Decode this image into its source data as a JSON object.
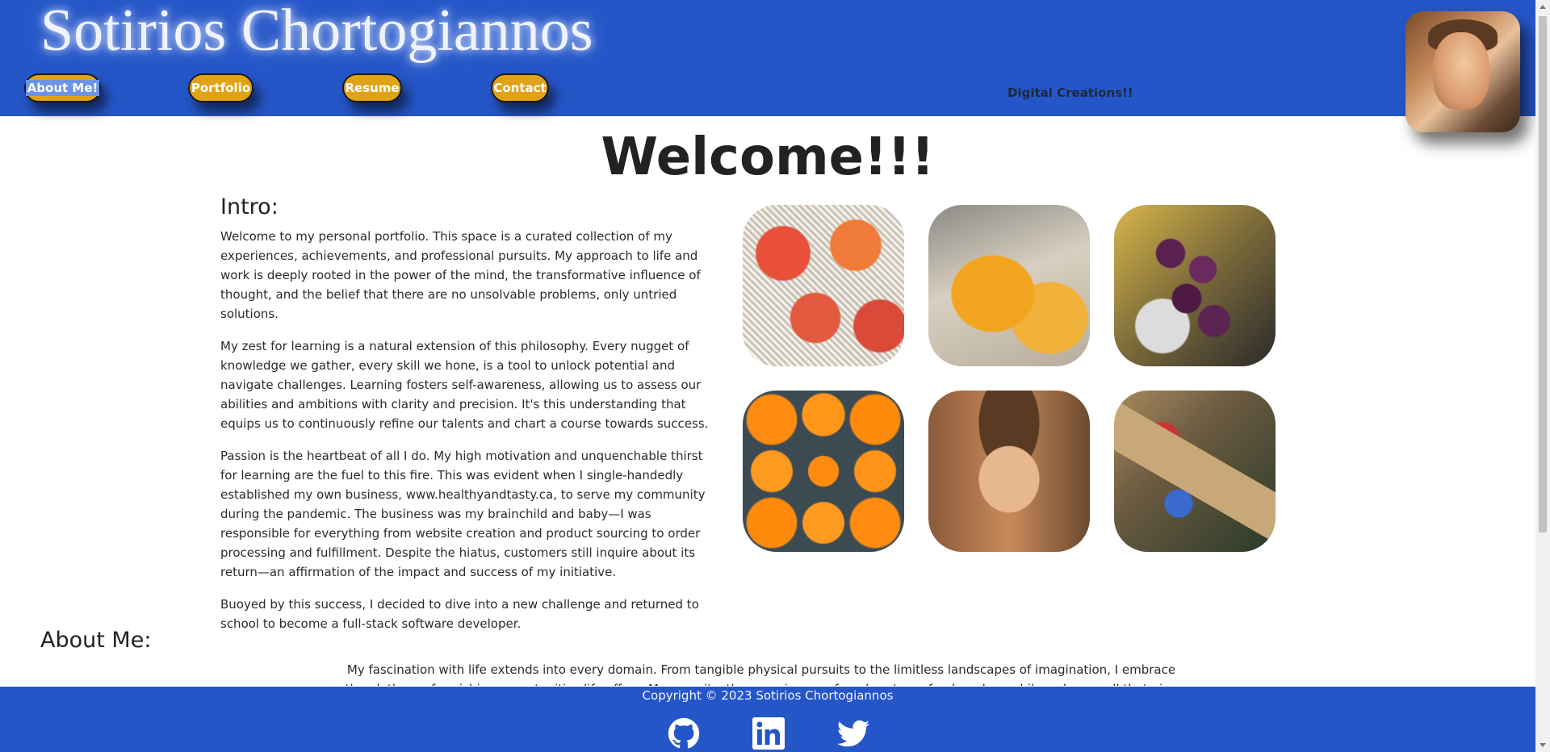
{
  "header": {
    "site_title": "Sotirios Chortogiannos",
    "tagline": "Digital Creations!!",
    "nav": [
      {
        "label": "About Me!"
      },
      {
        "label": "Portfolio"
      },
      {
        "label": "Resume"
      },
      {
        "label": "Contact"
      }
    ],
    "accent_color": "#2556c8",
    "button_color": "#e0a318"
  },
  "main": {
    "welcome": "Welcome!!!",
    "intro_title": "Intro:",
    "intro_paragraphs": [
      "Welcome to my personal portfolio. This space is a curated collection of my experiences, achievements, and professional pursuits. My approach to life and work is deeply rooted in the power of the mind, the transformative influence of thought, and the belief that there are no unsolvable problems, only untried solutions.",
      "My zest for learning is a natural extension of this philosophy. Every nugget of knowledge we gather, every skill we hone, is a tool to unlock potential and navigate challenges. Learning fosters self-awareness, allowing us to assess our abilities and ambitions with clarity and precision. It's this understanding that equips us to continuously refine our talents and chart a course towards success.",
      "Passion is the heartbeat of all I do. My high motivation and unquenchable thirst for learning are the fuel to this fire. This was evident when I single-handedly established my own business, www.healthyandtasty.ca, to serve my community during the pandemic. The business was my brainchild and baby—I was responsible for everything from website creation and product sourcing to order processing and fulfillment. Despite the hiatus, customers still inquire about its return—an affirmation of the impact and success of my initiative.",
      "Buoyed by this success, I decided to dive into a new challenge and returned to school to become a full-stack software developer."
    ],
    "gallery": [
      {
        "icon": "mangoes-photo"
      },
      {
        "icon": "peach-photo"
      },
      {
        "icon": "grapes-photo"
      },
      {
        "icon": "oranges-photo"
      },
      {
        "icon": "selfie-photo"
      },
      {
        "icon": "produce-boxes-photo"
      }
    ],
    "about_title": "About Me:",
    "about_text": "My fascination with life extends into every domain. From tangible physical pursuits to the limitless landscapes of imagination, I embrace the plethora of enriching opportunities life offers. My pursuits, the experiences of my heart, my food, and my philosophy are all that give me a platform for..."
  },
  "footer": {
    "copyright": "Copyright © 2023 Sotirios Chortogiannos",
    "social": [
      {
        "icon": "github-icon"
      },
      {
        "icon": "linkedin-icon"
      },
      {
        "icon": "twitter-icon"
      }
    ]
  }
}
